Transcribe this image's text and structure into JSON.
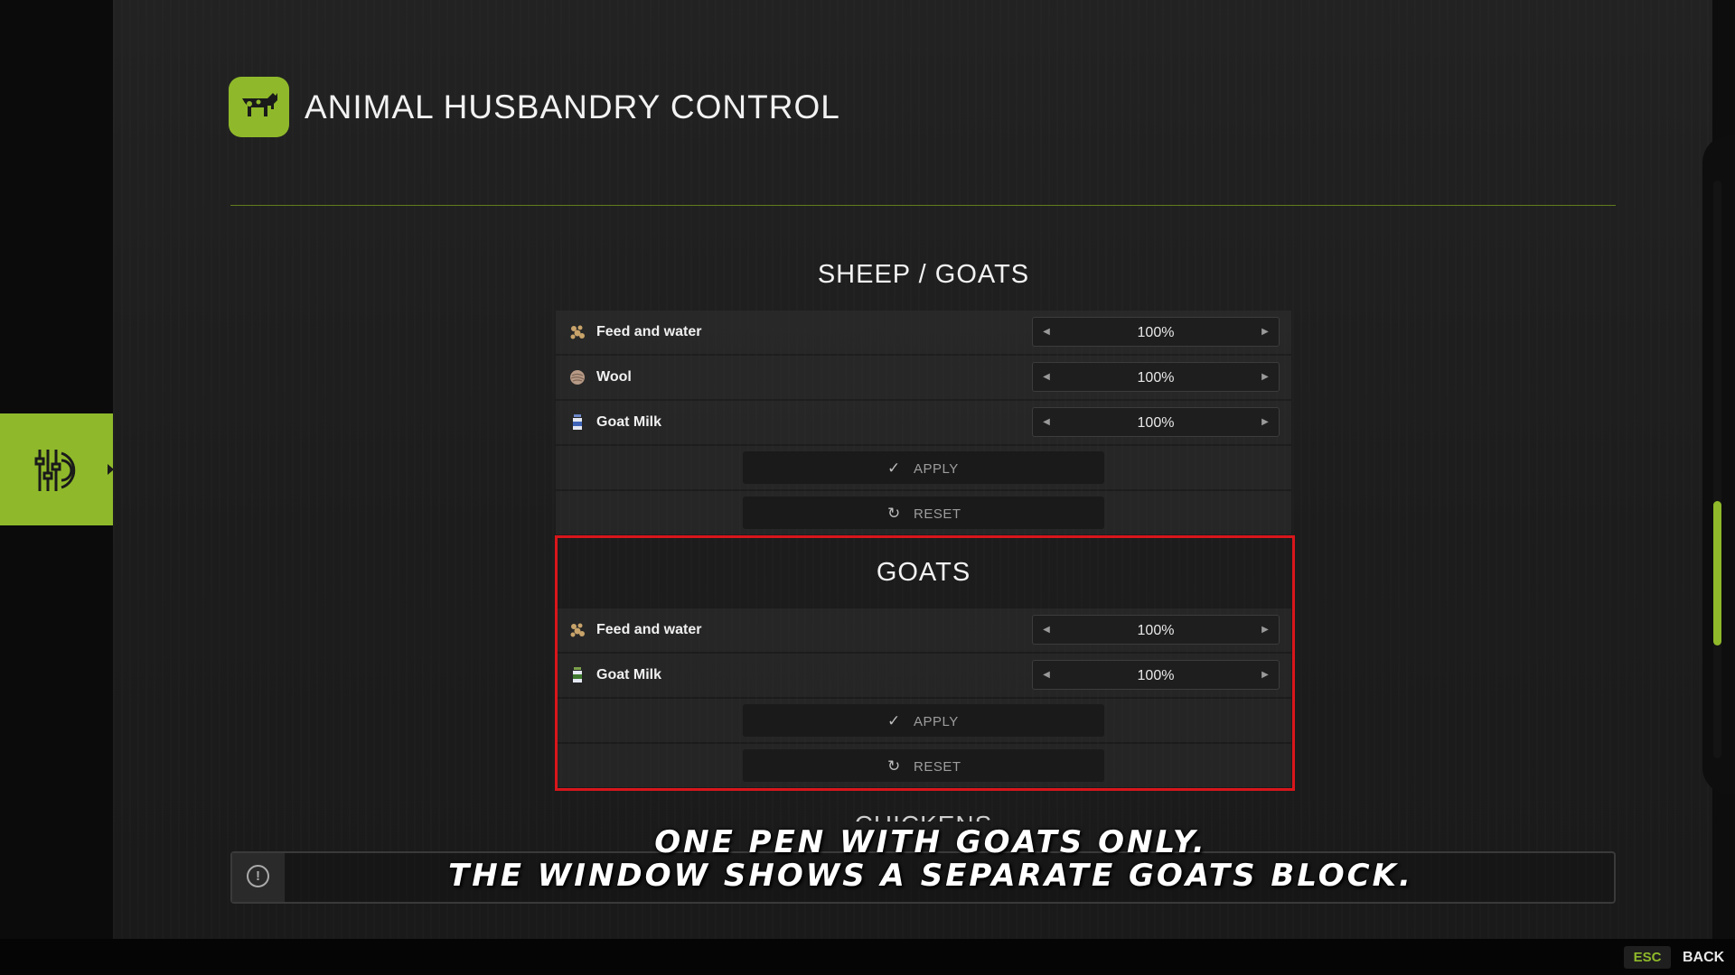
{
  "header": {
    "title": "ANIMAL HUSBANDRY CONTROL",
    "icon": "cow-icon"
  },
  "side_tab": {
    "icon": "gear-sliders-icon"
  },
  "sections": [
    {
      "title": "SHEEP / GOATS",
      "rows": [
        {
          "label": "Feed and water",
          "value": "100%",
          "icon": "feed-icon"
        },
        {
          "label": "Wool",
          "value": "100%",
          "icon": "wool-icon"
        },
        {
          "label": "Goat Milk",
          "value": "100%",
          "icon": "milk-icon"
        }
      ],
      "apply_label": "APPLY",
      "reset_label": "RESET"
    },
    {
      "title": "GOATS",
      "rows": [
        {
          "label": "Feed and water",
          "value": "100%",
          "icon": "feed-icon"
        },
        {
          "label": "Goat Milk",
          "value": "100%",
          "icon": "milk-icon"
        }
      ],
      "apply_label": "APPLY",
      "reset_label": "RESET"
    }
  ],
  "next_section_title": "CHICKENS",
  "caption": {
    "line1": "ONE PEN WITH GOATS ONLY.",
    "line2": "THE WINDOW SHOWS A SEPARATE GOATS BLOCK."
  },
  "footer": {
    "key": "ESC",
    "action": "BACK"
  },
  "colors": {
    "accent": "#8fb92a",
    "highlight": "#d8161b"
  }
}
